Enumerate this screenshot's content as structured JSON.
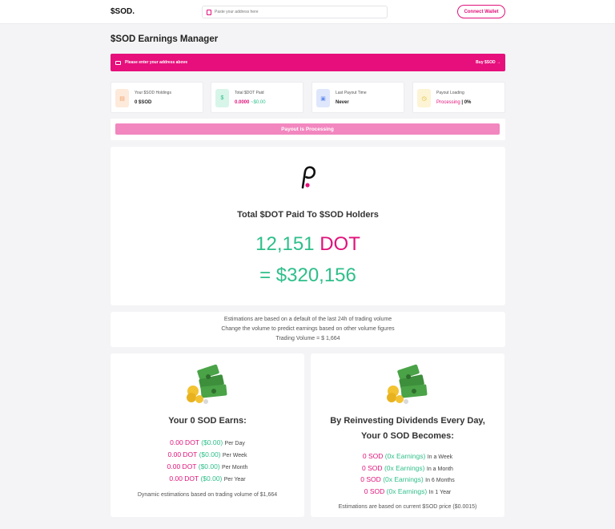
{
  "header": {
    "logo": "$SOD.",
    "search_placeholder": "Paste your address here",
    "connect_label": "Connect Wallet"
  },
  "page_title": "$SOD Earnings Manager",
  "banner": {
    "message": "Please enter your address above",
    "buy_label": "Buy $SOD →"
  },
  "stats": [
    {
      "label": "Your $SOD Holdings",
      "value": "0 $SOD",
      "icon": "wallet-icon",
      "color": "#f0a06a",
      "bg": "#fdeadb"
    },
    {
      "label": "Total $DOT Paid",
      "value_a": "0.0000",
      "value_b": "~$0.00",
      "icon": "dollar-icon",
      "color": "#2ebf8a",
      "bg": "#d8f5ea"
    },
    {
      "label": "Last Payout Time",
      "value": "Never",
      "icon": "lock-icon",
      "color": "#6a8ff0",
      "bg": "#dfe7fc"
    },
    {
      "label": "Payout Loading",
      "value_a": "Processing",
      "value_b": "| 0%",
      "icon": "clock-icon",
      "color": "#e0b92e",
      "bg": "#fcf4d4"
    }
  ],
  "progress": {
    "label": "Payout is Processing",
    "percent": 100
  },
  "hero": {
    "title": "Total $DOT Paid To $SOD Holders",
    "dot_amount": "12,151",
    "dot_unit": "DOT",
    "usd_amount": "= $320,156"
  },
  "note": {
    "line1": "Estimations are based on a default of the last 24h of trading volume",
    "line2": "Change the volume to predict earnings based on other volume figures",
    "line3": "Trading Volume = $ 1,664"
  },
  "earns_card": {
    "title": "Your 0 SOD Earns:",
    "rows": [
      {
        "dot": "0.00 DOT",
        "usd": "($0.00)",
        "period": "Per Day"
      },
      {
        "dot": "0.00 DOT",
        "usd": "($0.00)",
        "period": "Per Week"
      },
      {
        "dot": "0.00 DOT",
        "usd": "($0.00)",
        "period": "Per Month"
      },
      {
        "dot": "0.00 DOT",
        "usd": "($0.00)",
        "period": "Per Year"
      }
    ],
    "footer": "Dynamic estimations based on trading volume of $1,664"
  },
  "reinvest_card": {
    "title_line1": "By Reinvesting Dividends Every Day,",
    "title_line2": "Your 0 SOD Becomes:",
    "rows": [
      {
        "sod": "0 SOD",
        "earn": "(0x Earnings)",
        "period": "In a Week"
      },
      {
        "sod": "0 SOD",
        "earn": "(0x Earnings)",
        "period": "In a Month"
      },
      {
        "sod": "0 SOD",
        "earn": "(0x Earnings)",
        "period": "In 6 Months"
      },
      {
        "sod": "0 SOD",
        "earn": "(0x Earnings)",
        "period": "In 1 Year"
      }
    ],
    "footer": "Estimations are based on current $SOD price ($0.0015)"
  }
}
